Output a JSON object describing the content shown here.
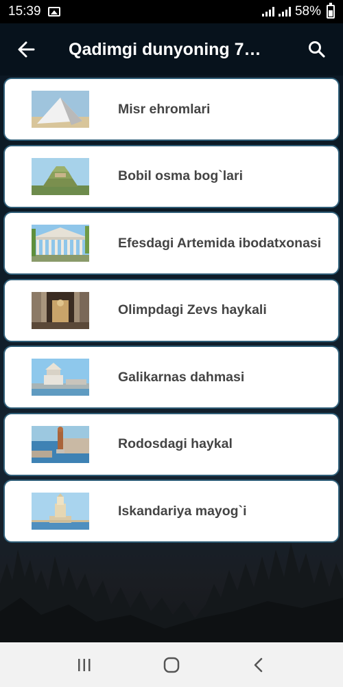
{
  "status_bar": {
    "time": "15:39",
    "battery": "58%",
    "icons": [
      "gallery-icon",
      "signal-icon",
      "signal-icon",
      "battery-icon"
    ]
  },
  "app_bar": {
    "title": "Qadimgi dunyoning 7…",
    "back_icon": "arrow-left-icon",
    "search_icon": "search-icon"
  },
  "items": [
    {
      "label": "Misr ehromlari",
      "thumb": "pyramid-thumbnail"
    },
    {
      "label": "Bobil osma bog`lari",
      "thumb": "hanging-gardens-thumbnail"
    },
    {
      "label": "Efesdagi Artemida ibodatxonasi",
      "thumb": "temple-of-artemis-thumbnail"
    },
    {
      "label": "Olimpdagi Zevs haykali",
      "thumb": "statue-of-zeus-thumbnail"
    },
    {
      "label": "Galikarnas dahmasi",
      "thumb": "mausoleum-thumbnail"
    },
    {
      "label": "Rodosdagi haykal",
      "thumb": "colossus-of-rhodes-thumbnail"
    },
    {
      "label": "Iskandariya mayog`i",
      "thumb": "lighthouse-of-alexandria-thumbnail"
    }
  ],
  "nav_bar": {
    "icons": [
      "recent-apps-icon",
      "home-icon",
      "back-icon"
    ]
  },
  "colors": {
    "card_border": "#2f5e78",
    "app_bar_bg": "#07121c",
    "text_dark": "#444444"
  }
}
